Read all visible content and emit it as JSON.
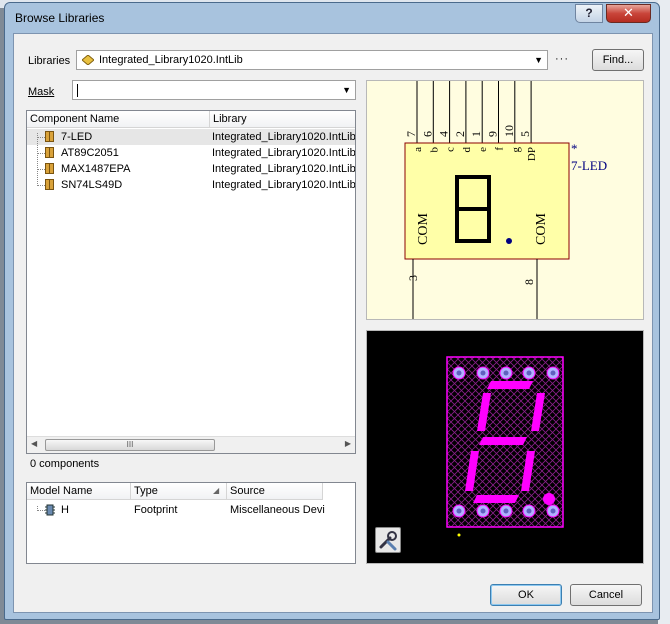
{
  "window": {
    "title": "Browse Libraries",
    "help_label": "?",
    "close_label": "✕"
  },
  "libraries": {
    "label": "Libraries",
    "value": "Integrated_Library1020.IntLib",
    "more_label": "···",
    "find_label": "Find..."
  },
  "mask": {
    "label": "Mask",
    "value": ""
  },
  "components": {
    "headers": [
      "Component Name",
      "Library"
    ],
    "rows": [
      {
        "name": "7-LED",
        "library": "Integrated_Library1020.IntLib"
      },
      {
        "name": "AT89C2051",
        "library": "Integrated_Library1020.IntLib"
      },
      {
        "name": "MAX1487EPA",
        "library": "Integrated_Library1020.IntLib"
      },
      {
        "name": "SN74LS49D",
        "library": "Integrated_Library1020.IntLib"
      }
    ],
    "count_label": "0 components",
    "scroll_grip": "III"
  },
  "models": {
    "headers": [
      "Model Name",
      "Type",
      "Source"
    ],
    "rows": [
      {
        "name": "H",
        "type": "Footprint",
        "source": "Miscellaneous Devi"
      }
    ]
  },
  "symbol": {
    "designator": "*",
    "name": "7-LED",
    "top_pin_numbers": [
      "7",
      "6",
      "4",
      "2",
      "1",
      "9",
      "10",
      "5"
    ],
    "inner_labels": [
      "a",
      "b",
      "c",
      "d",
      "e",
      "f",
      "g",
      "DP"
    ],
    "com_left": "COM",
    "com_right": "COM",
    "bottom_left_pin": "3",
    "bottom_right_pin": "8",
    "colors": {
      "body_fill": "#ffffa8",
      "body_stroke": "#8b0000",
      "text": "#000080"
    }
  },
  "footprint": {
    "colors": {
      "outline": "#ff00ff",
      "segment": "#ff00ff",
      "pad": "#b0b0ff"
    }
  },
  "buttons": {
    "ok": "OK",
    "cancel": "Cancel"
  }
}
